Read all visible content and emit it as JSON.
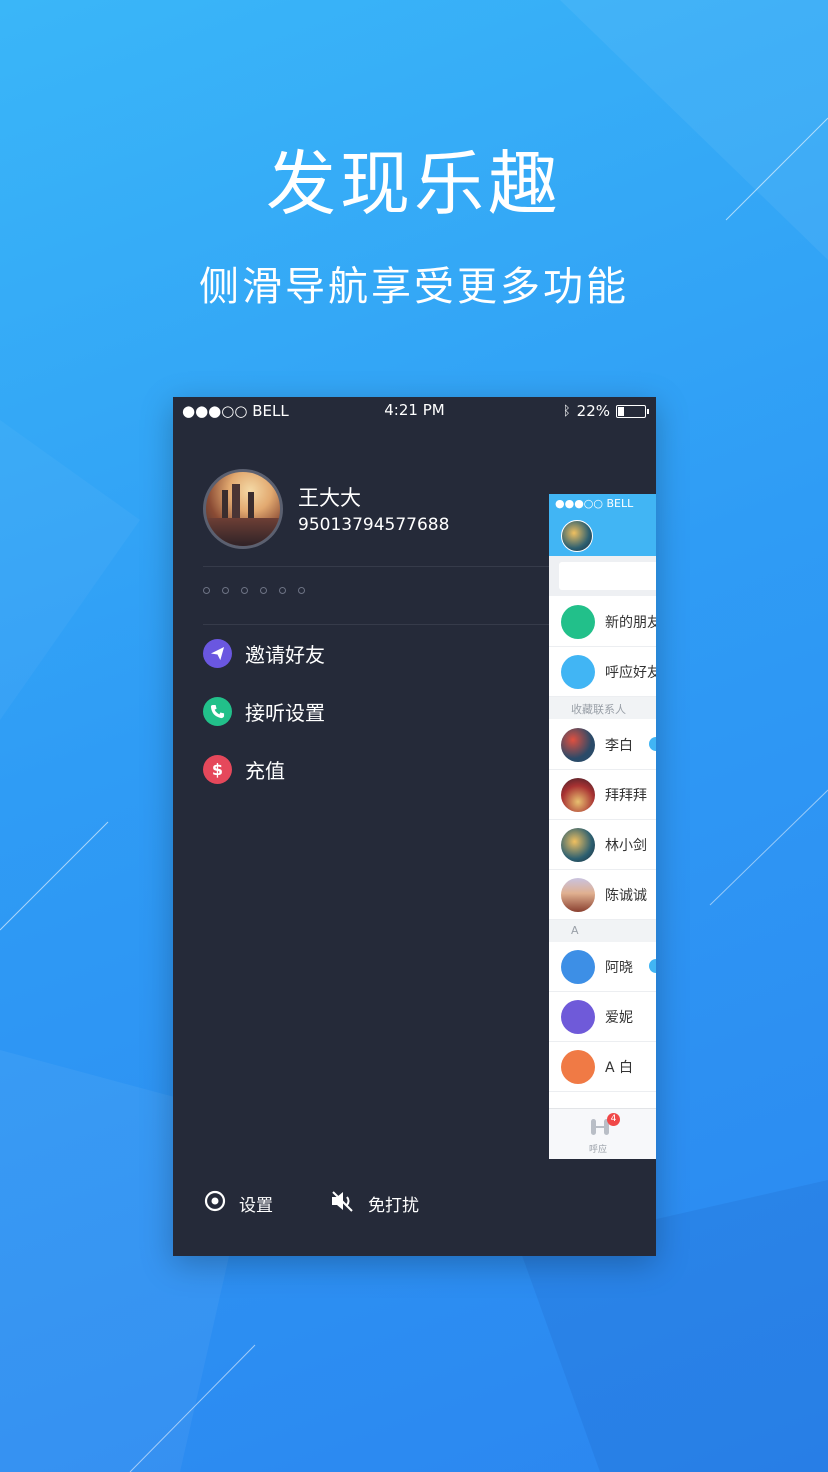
{
  "hero": {
    "title": "发现乐趣",
    "subtitle": "侧滑导航享受更多功能"
  },
  "status_bar": {
    "carrier": "●●●○○ BELL",
    "time": "4:21 PM",
    "battery": "22%"
  },
  "profile": {
    "name": "王大大",
    "phone": "95013794577688"
  },
  "menu": [
    {
      "label": "邀请好友",
      "icon": "paper-plane-icon",
      "color": "#6a57e0"
    },
    {
      "label": "接听设置",
      "icon": "phone-icon",
      "color": "#22c08a"
    },
    {
      "label": "充值",
      "icon": "dollar-icon",
      "color": "#e5485b"
    }
  ],
  "bottom": {
    "settings": "设置",
    "dnd": "免打扰"
  },
  "overlay": {
    "status": "●●●○○ BELL",
    "rows": [
      {
        "label": "新的朋友",
        "color": "#22c08a"
      },
      {
        "label": "呼应好友",
        "color": "#41b5f4"
      }
    ],
    "favorites_header": "收藏联系人",
    "favorites": [
      {
        "label": "李白",
        "color": "#2a4a68"
      },
      {
        "label": "拜拜拜",
        "color": "#a83232"
      },
      {
        "label": "林小剑",
        "color": "#2c5f70"
      },
      {
        "label": "陈诚诚",
        "color": "#c08060"
      }
    ],
    "letter_header": "A",
    "contacts": [
      {
        "label": "阿晓",
        "color": "#3d8fe6"
      },
      {
        "label": "爱妮",
        "color": "#6f5ad9"
      },
      {
        "label": "A 白",
        "color": "#f07a45"
      }
    ],
    "tab_label": "呼应",
    "tab_badge": "4"
  },
  "colors": {
    "accent": "#41b5f4",
    "panel": "#252a39"
  }
}
